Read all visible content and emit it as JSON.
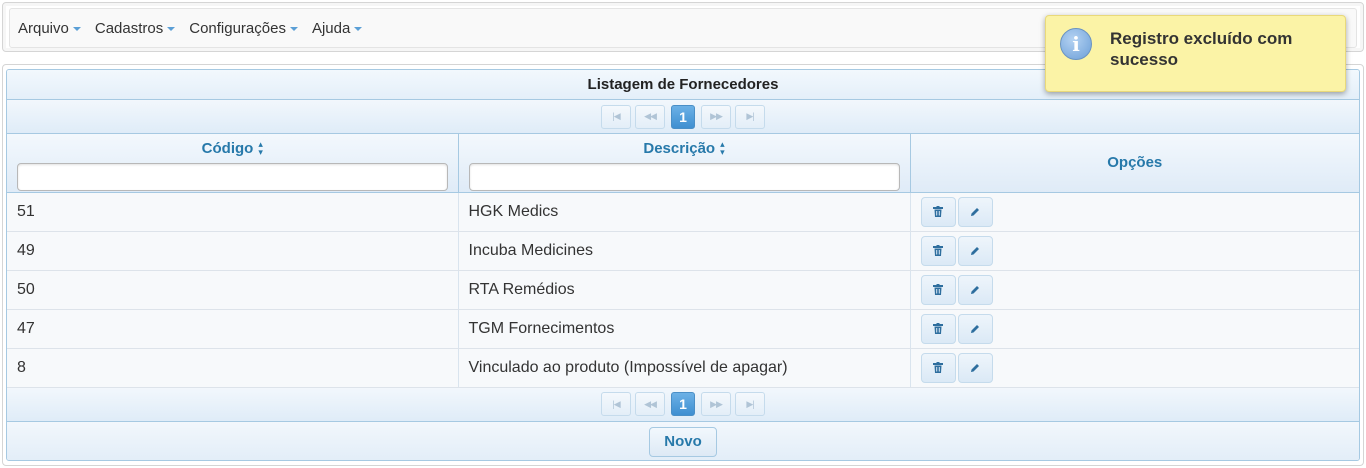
{
  "menu": [
    {
      "label": "Arquivo"
    },
    {
      "label": "Cadastros"
    },
    {
      "label": "Configurações"
    },
    {
      "label": "Ajuda"
    }
  ],
  "grid": {
    "title": "Listagem de Fornecedores",
    "current_page": "1",
    "columns": {
      "code": "Código",
      "description": "Descrição",
      "options": "Opções"
    },
    "rows": [
      {
        "code": "51",
        "description": "HGK Medics"
      },
      {
        "code": "49",
        "description": "Incuba Medicines"
      },
      {
        "code": "50",
        "description": "RTA Remédios"
      },
      {
        "code": "47",
        "description": "TGM Fornecimentos"
      },
      {
        "code": "8",
        "description": "Vinculado ao produto (Impossível de apagar)"
      }
    ],
    "new_button": "Novo"
  },
  "growl": {
    "message": "Registro excluído com sucesso",
    "icon": "info-icon"
  },
  "icons": {
    "row_delete": "trash-icon",
    "row_edit": "pencil-icon",
    "sort": "sort-icon"
  },
  "colors": {
    "accent": "#2779aa",
    "page_active": "#3f8fd1",
    "growl_bg": "#fbf3a6"
  }
}
